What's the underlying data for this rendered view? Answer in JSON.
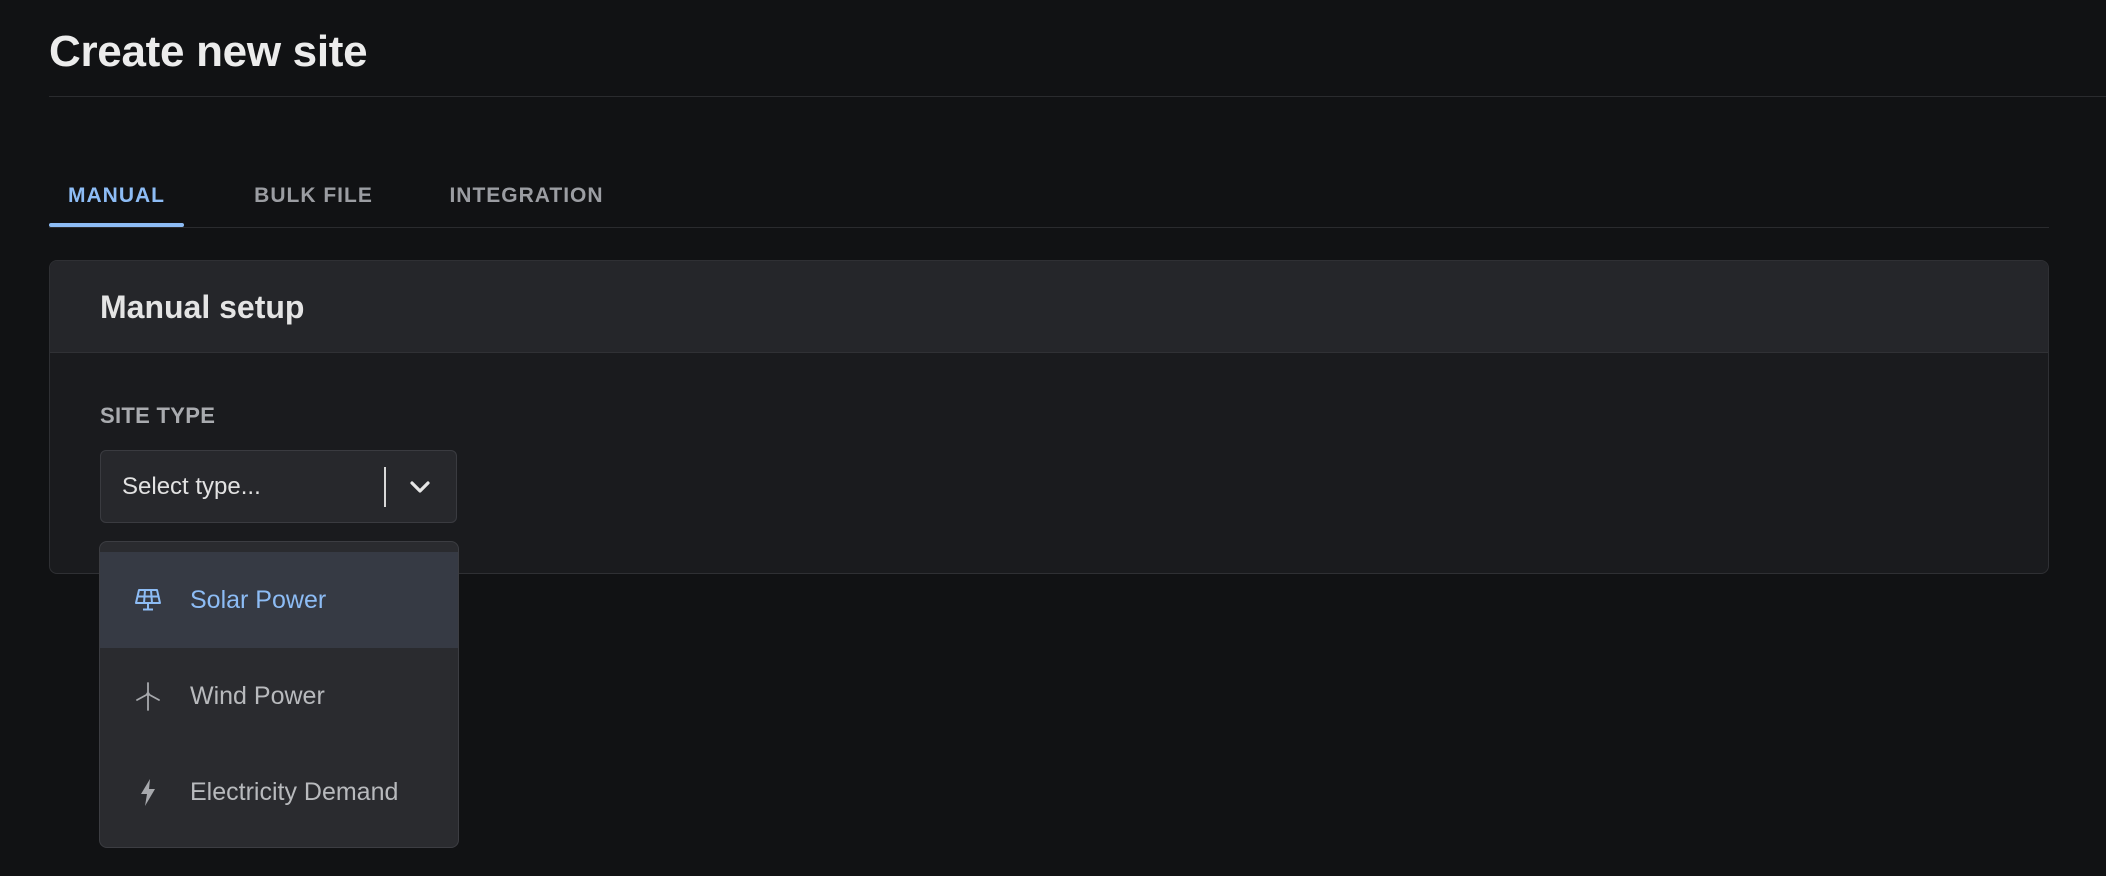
{
  "page": {
    "title": "Create new site"
  },
  "tabs": [
    {
      "label": "MANUAL",
      "active": true
    },
    {
      "label": "BULK FILE",
      "active": false
    },
    {
      "label": "INTEGRATION",
      "active": false
    }
  ],
  "card": {
    "title": "Manual setup",
    "field_label": "SITE TYPE",
    "select": {
      "placeholder": "Select type...",
      "icon": "chevron-down-icon"
    }
  },
  "dropdown": {
    "options": [
      {
        "label": "Solar Power",
        "icon": "solar-panel-icon",
        "highlighted": true
      },
      {
        "label": "Wind Power",
        "icon": "wind-turbine-icon",
        "highlighted": false
      },
      {
        "label": "Electricity Demand",
        "icon": "lightning-bolt-icon",
        "highlighted": false
      }
    ]
  },
  "colors": {
    "background": "#111214",
    "accent": "#8dbcf5",
    "card": "#1a1b1e",
    "card_header": "#25262a",
    "dropdown": "#2a2b2f",
    "highlight": "#363a44"
  }
}
